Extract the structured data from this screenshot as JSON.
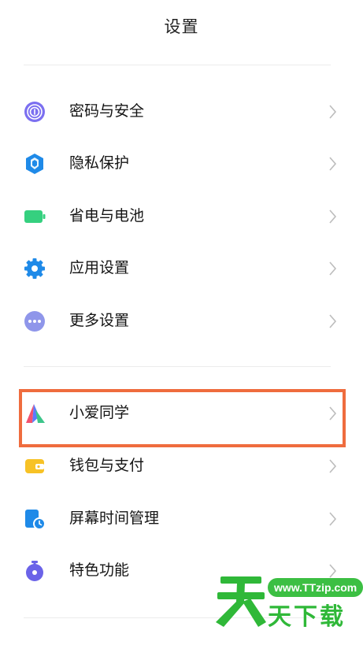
{
  "header": {
    "title": "设置"
  },
  "group1": [
    {
      "label": "密码与安全",
      "icon": "fingerprint-icon"
    },
    {
      "label": "隐私保护",
      "icon": "privacy-shield-icon"
    },
    {
      "label": "省电与电池",
      "icon": "battery-icon"
    },
    {
      "label": "应用设置",
      "icon": "gear-icon"
    },
    {
      "label": "更多设置",
      "icon": "more-dots-icon"
    }
  ],
  "group2": [
    {
      "label": "小爱同学",
      "icon": "xiaoai-assistant-icon"
    },
    {
      "label": "钱包与支付",
      "icon": "wallet-icon"
    },
    {
      "label": "屏幕时间管理",
      "icon": "screen-time-icon"
    },
    {
      "label": "特色功能",
      "icon": "special-features-icon"
    }
  ],
  "watermark": {
    "url": "www.TTzip.com",
    "text": "天下载",
    "big_char": "天"
  },
  "colors": {
    "highlight": "#ef6c3e",
    "watermark": "#2fb838"
  }
}
